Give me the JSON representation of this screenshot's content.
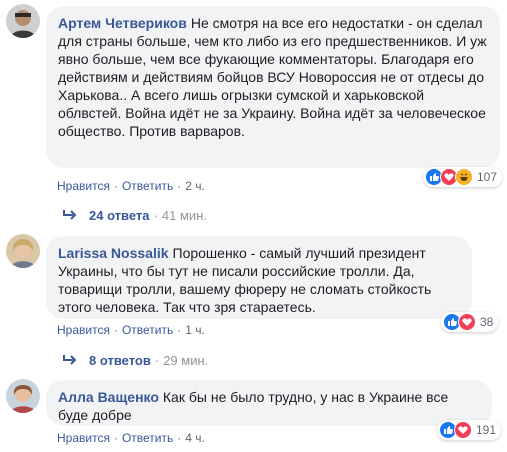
{
  "comments": [
    {
      "author": "Артем Четвериков",
      "text": "Не смотря на все его недостатки - он сделал для страны больше, чем кто либо из его предшественников. И уж явно больше, чем все фукающие комментаторы. Благодаря его действиям и действиям бойцов ВСУ Новороссия не от отдесы до Харькова.. А всего лишь огрызки сумской и харьковской облвстей. Война идёт не за Украину. Война идёт за человеческое общество. Против варваров.",
      "like_label": "Нравится",
      "reply_label": "Ответить",
      "time": "2 ч.",
      "reaction_count": "107",
      "reactions": [
        "like-icon",
        "love-icon",
        "haha-icon"
      ],
      "replies_label": "24 ответа",
      "replies_time": "41 мин."
    },
    {
      "author": "Larissa Nossalik",
      "text": "Порошенко - самый лучший президент Украины, что бы тут не писали российские тролли. Да, товарищи тролли, вашему фюреру не сломать стойкость этого человека. Так что зря стараетесь.",
      "like_label": "Нравится",
      "reply_label": "Ответить",
      "time": "1 ч.",
      "reaction_count": "38",
      "reactions": [
        "like-icon",
        "love-icon"
      ],
      "replies_label": "8 ответов",
      "replies_time": "29 мин."
    },
    {
      "author": "Алла Ващенко",
      "text": "Как бы не было трудно, у нас в Украине все буде добре",
      "like_label": "Нравится",
      "reply_label": "Ответить",
      "time": "4 ч.",
      "reaction_count": "191",
      "reactions": [
        "like-icon",
        "love-icon"
      ]
    }
  ],
  "colors": {
    "link": "#385898",
    "bubble": "#f2f3f5",
    "meta": "#606770",
    "like": "#1877f2",
    "love": "#f33e58",
    "haha": "#f7b125"
  }
}
